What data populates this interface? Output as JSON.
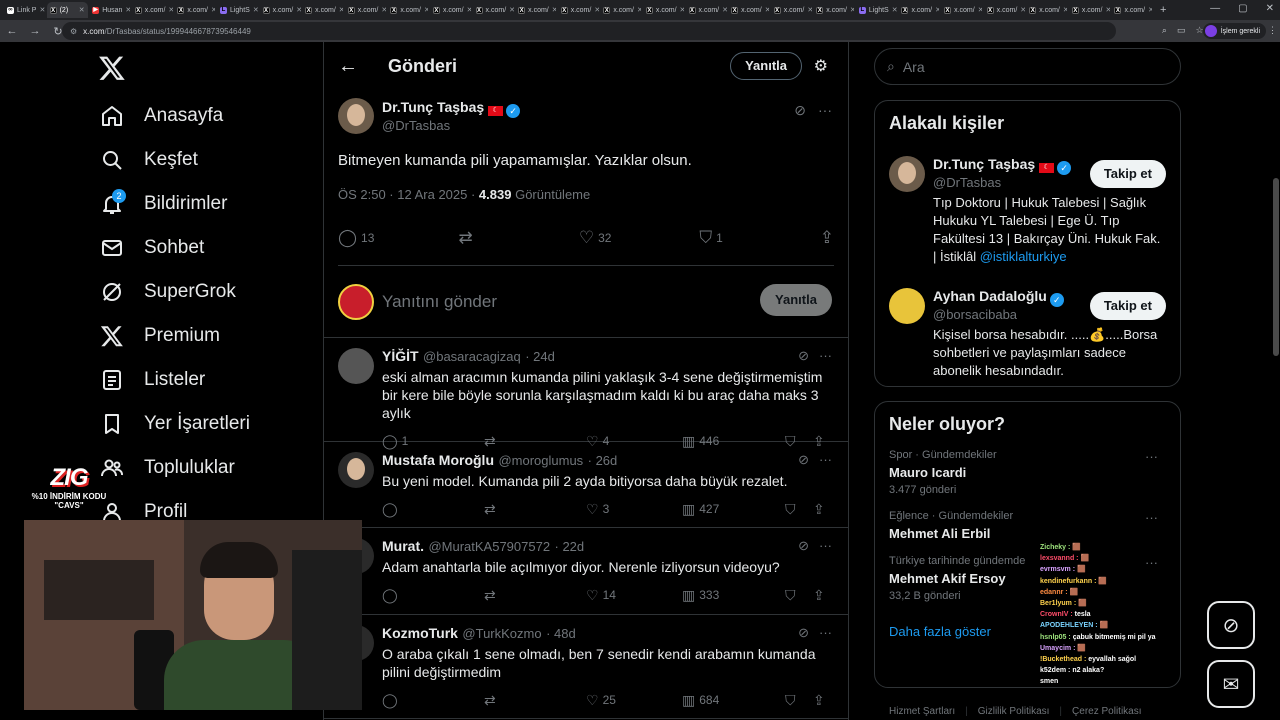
{
  "browser": {
    "tabs": [
      {
        "label": "Link P",
        "fav": "link",
        "active": false
      },
      {
        "label": "(2)",
        "fav": "x",
        "active": true
      },
      {
        "label": "Husan",
        "fav": "youtube",
        "active": false
      },
      {
        "label": "x.com/",
        "fav": "x",
        "active": false
      },
      {
        "label": "x.com/",
        "fav": "x",
        "active": false
      },
      {
        "label": "LightS",
        "fav": "lights",
        "active": false
      },
      {
        "label": "x.com/",
        "fav": "x",
        "active": false
      },
      {
        "label": "x.com/",
        "fav": "x",
        "active": false
      },
      {
        "label": "x.com/",
        "fav": "x",
        "active": false
      },
      {
        "label": "x.com/",
        "fav": "x",
        "active": false
      },
      {
        "label": "x.com/",
        "fav": "x",
        "active": false
      },
      {
        "label": "x.com/",
        "fav": "x",
        "active": false
      },
      {
        "label": "x.com/",
        "fav": "x",
        "active": false
      },
      {
        "label": "x.com/",
        "fav": "x",
        "active": false
      },
      {
        "label": "x.com/",
        "fav": "x",
        "active": false
      },
      {
        "label": "x.com/",
        "fav": "x",
        "active": false
      },
      {
        "label": "x.com/",
        "fav": "x",
        "active": false
      },
      {
        "label": "x.com/",
        "fav": "x",
        "active": false
      },
      {
        "label": "x.com/",
        "fav": "x",
        "active": false
      },
      {
        "label": "x.com/",
        "fav": "x",
        "active": false
      },
      {
        "label": "LightS",
        "fav": "lights",
        "active": false
      },
      {
        "label": "x.com/",
        "fav": "x",
        "active": false
      },
      {
        "label": "x.com/",
        "fav": "x",
        "active": false
      },
      {
        "label": "x.com/",
        "fav": "x",
        "active": false
      },
      {
        "label": "x.com/",
        "fav": "x",
        "active": false
      },
      {
        "label": "x.com/",
        "fav": "x",
        "active": false
      },
      {
        "label": "x.com/",
        "fav": "x",
        "active": false
      }
    ],
    "url_host": "x.com",
    "url_path": "/DrTasbas/status/1999446678739546449",
    "profile_label": "İşlem gerekli"
  },
  "nav": {
    "items": [
      {
        "label": "Anasayfa",
        "icon": "home-icon"
      },
      {
        "label": "Keşfet",
        "icon": "search-icon"
      },
      {
        "label": "Bildirimler",
        "icon": "bell-icon",
        "badge": "2"
      },
      {
        "label": "Sohbet",
        "icon": "mail-icon"
      },
      {
        "label": "SuperGrok",
        "icon": "grok-icon"
      },
      {
        "label": "Premium",
        "icon": "x-icon"
      },
      {
        "label": "Listeler",
        "icon": "list-icon"
      },
      {
        "label": "Yer İşaretleri",
        "icon": "bookmark-icon"
      },
      {
        "label": "Topluluklar",
        "icon": "people-icon"
      },
      {
        "label": "Profil",
        "icon": "person-icon"
      }
    ]
  },
  "header": {
    "title": "Gönderi",
    "reply_button": "Yanıtla"
  },
  "post": {
    "name": "Dr.Tunç Taşbaş",
    "handle": "@DrTasbas",
    "text": "Bitmeyen kumanda pili yapamamışlar. Yazıklar olsun.",
    "time": "ÖS 2:50 · 12 Ara 2025 · ",
    "views": "4.839",
    "views_label": " Görüntüleme",
    "replies": "13",
    "likes": "32",
    "bookmarks": "1"
  },
  "composer": {
    "placeholder": "Yanıtını gönder",
    "button": "Yanıtla"
  },
  "replies": [
    {
      "name": "YİĞİT",
      "handle": "@basaracagizaq",
      "age": "· 24d",
      "text": "eski alman aracımın kumanda pilini yaklaşık 3-4 sene değiştirmemiştim bir kere bile böyle sorunla karşılaşmadım kaldı ki bu araç daha maks 3 aylık",
      "replies": "1",
      "likes": "4",
      "views": "446",
      "avatar": "car"
    },
    {
      "name": "Mustafa Moroğlu",
      "handle": "@moroglumus",
      "age": "· 26d",
      "text": "Bu yeni model. Kumanda pili 2 ayda bitiyorsa daha büyük rezalet.",
      "replies": "",
      "likes": "3",
      "views": "427",
      "avatar": "dark"
    },
    {
      "name": "Murat.",
      "handle": "@MuratKA57907572",
      "age": "· 22d",
      "text": "Adam anahtarla bile açılmıyor diyor. Nerenle izliyorsun videoyu?",
      "replies": "",
      "likes": "14",
      "views": "333",
      "avatar": "none"
    },
    {
      "name": "KozmoTurk",
      "handle": "@TurkKozmo",
      "age": "· 48d",
      "text": "O araba çıkalı 1 sene olmadı, ben 7 senedir kendi arabamın kumanda pilini değiştirmedim",
      "replies": "",
      "likes": "25",
      "views": "684",
      "avatar": "none"
    }
  ],
  "search": {
    "placeholder": "Ara"
  },
  "related": {
    "title": "Alakalı kişiler",
    "people": [
      {
        "name": "Dr.Tunç Taşbaş",
        "handle": "@DrTasbas",
        "follow": "Takip et",
        "bio": "Tıp Doktoru | Hukuk Talebesi | Sağlık Hukuku YL Talebesi | Ege Ü. Tıp Fakültesi 13 | Bakırçay Üni. Hukuk Fak. | İstiklâl ",
        "mention": "@istiklalturkiye"
      },
      {
        "name": "Ayhan Dadaloğlu",
        "handle": "@borsacibaba",
        "follow": "Takip et",
        "bio": "Kişisel borsa hesabıdır. .....💰.....Borsa sohbetleri ve paylaşımları sadece abonelik hesabındadır.",
        "mention": ""
      }
    ]
  },
  "trends": {
    "title": "Neler oluyor?",
    "items": [
      {
        "category": "Spor · Gündemdekiler",
        "name": "Mauro Icardi",
        "count": "3.477 gönderi"
      },
      {
        "category": "Eğlence · Gündemdekiler",
        "name": "Mehmet Ali Erbil",
        "count": ""
      },
      {
        "category": "Türkiye tarihinde gündemde",
        "name": "Mehmet Akif Ersoy",
        "count": "33,2 B gönderi"
      }
    ],
    "show_more": "Daha fazla göster"
  },
  "footer": [
    "Hizmet Şartları",
    "Gizlilik Politikası",
    "Çerez Politikası"
  ],
  "stream": {
    "logo": "ZIG",
    "promo": "%10 İNDİRİM KODU \"CAVS\"",
    "chat": [
      {
        "user": "Zicheky :",
        "msg": "🟫",
        "color": "#9ee37d"
      },
      {
        "user": "lexsvannd :",
        "msg": "🟫",
        "color": "#ff4d6a"
      },
      {
        "user": "evrmsvm :",
        "msg": "🟫",
        "color": "#d9a3ff"
      },
      {
        "user": "kendinefurkann :",
        "msg": "🟫",
        "color": "#ffd24d"
      },
      {
        "user": "edannr :",
        "msg": "🟫",
        "color": "#ff8c42"
      },
      {
        "user": "Ber1lyum :",
        "msg": "🟫",
        "color": "#ffd24d"
      },
      {
        "user": "CrownIV :",
        "msg": "tesla",
        "color": "#ff4d6a"
      },
      {
        "user": "APODEHLEYEN :",
        "msg": "🟫",
        "color": "#7ad3ff"
      },
      {
        "user": "hsnlp05 :",
        "msg": "çabuk bitmemiş mi pil ya",
        "color": "#9ee37d"
      },
      {
        "user": "Umaycim :",
        "msg": "🟫",
        "color": "#d9a3ff"
      },
      {
        "user": "!Buckethead :",
        "msg": "eyvallah sağol",
        "color": "#ffd24d"
      },
      {
        "user": "k52dem :",
        "msg": "n2 alaka?",
        "color": "#ffffff"
      },
      {
        "user": "smen",
        "msg": "",
        "color": "#ffffff"
      }
    ]
  }
}
